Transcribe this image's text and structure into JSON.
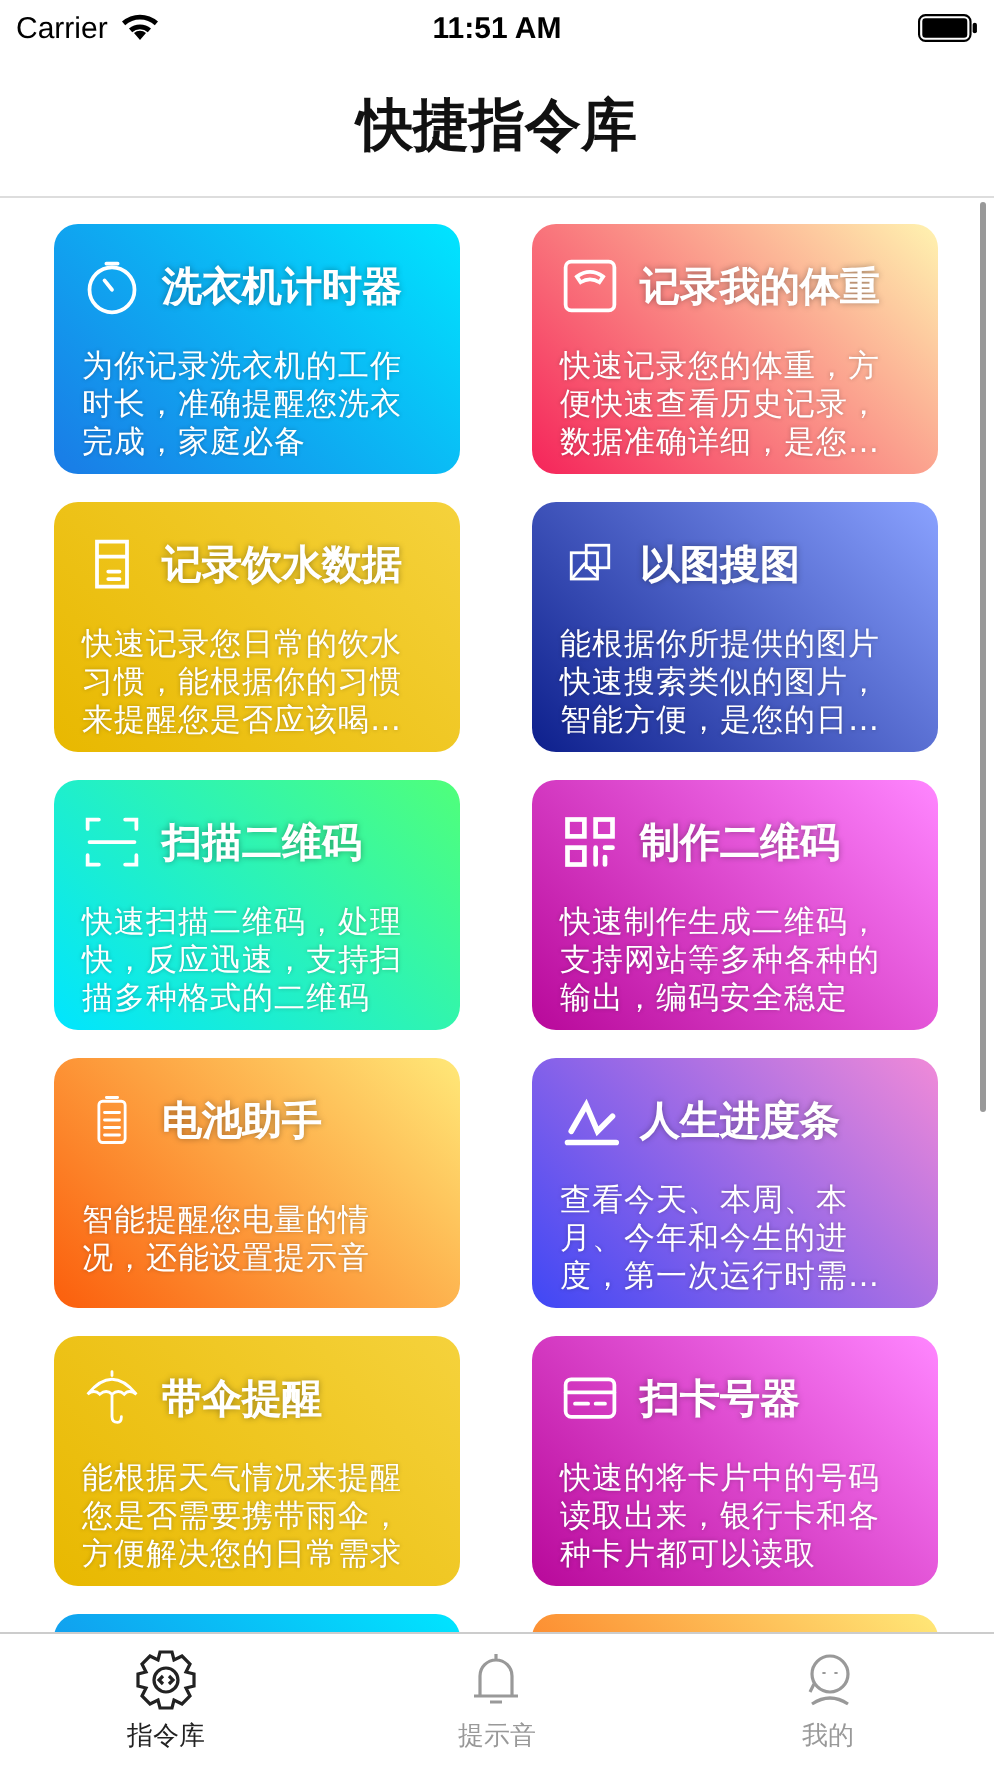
{
  "status_bar": {
    "carrier": "Carrier",
    "time": "11:51 AM"
  },
  "nav": {
    "title": "快捷指令库"
  },
  "cards": [
    {
      "kind": "blue",
      "title": "洗衣机计时器",
      "description": "为你记录洗衣机的工作时长，准确提醒您洗衣完成，家庭必备"
    },
    {
      "kind": "coral",
      "title": "记录我的体重",
      "description": "快速记录您的体重，方便快速查看历史记录，数据准确详细，是您…"
    },
    {
      "kind": "yellow",
      "title": "记录饮水数据",
      "description": "快速记录您日常的饮水习惯，能根据你的习惯来提醒您是否应该喝…"
    },
    {
      "kind": "indigo",
      "title": "以图搜图",
      "description": "能根据你所提供的图片快速搜索类似的图片，智能方便，是您的日…"
    },
    {
      "kind": "green",
      "title": "扫描二维码",
      "description": "快速扫描二维码，处理快，反应迅速，支持扫描多种格式的二维码"
    },
    {
      "kind": "magenta",
      "title": "制作二维码",
      "description": "快速制作生成二维码，支持网站等多种各种的输出，编码安全稳定"
    },
    {
      "kind": "orange",
      "title": "电池助手",
      "description": "智能提醒您电量的情况，还能设置提示音"
    },
    {
      "kind": "violet",
      "title": "人生进度条",
      "description": "查看今天、本周、本月、今年和今生的进度，第一次运行时需…"
    },
    {
      "kind": "yellow",
      "title": "带伞提醒",
      "description": "能根据天气情况来提醒您是否需要携带雨伞，方便解决您的日常需求"
    },
    {
      "kind": "magenta",
      "title": "扫卡号器",
      "description": "快速的将卡片中的号码读取出来，银行卡和各种卡片都可以读取"
    },
    {
      "kind": "blue"
    },
    {
      "kind": "orange"
    }
  ],
  "tabs": [
    {
      "label": "指令库",
      "selected": true
    },
    {
      "label": "提示音",
      "selected": false
    },
    {
      "label": "我的",
      "selected": false
    }
  ]
}
